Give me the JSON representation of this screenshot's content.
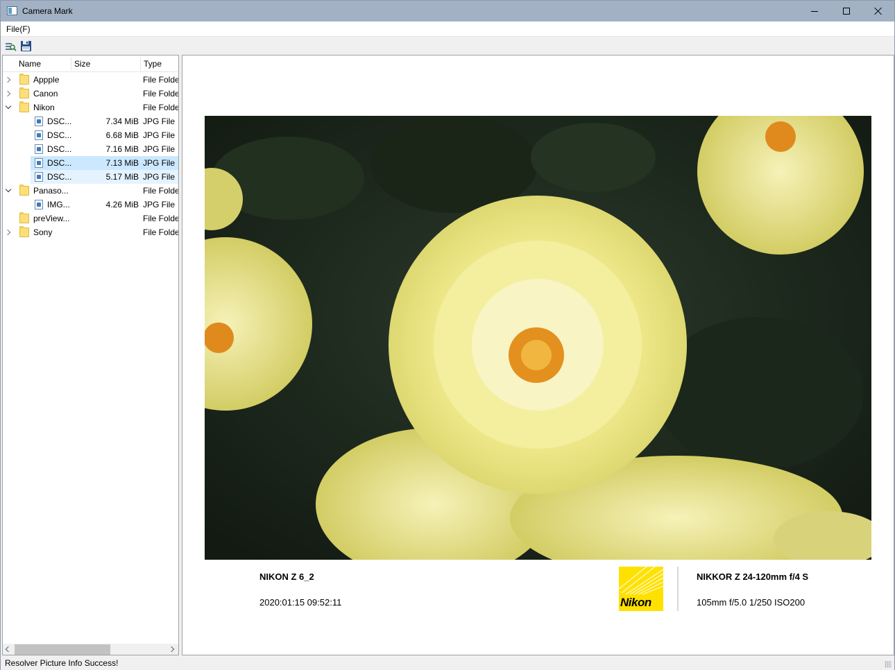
{
  "window": {
    "title": "Camera Mark"
  },
  "menu": {
    "file_label": "File(F)"
  },
  "tree": {
    "columns": {
      "name": "Name",
      "size": "Size",
      "type": "Type"
    },
    "rows": [
      {
        "name": "Appple",
        "size": "",
        "type": "File Folde"
      },
      {
        "name": "Canon",
        "size": "",
        "type": "File Folde"
      },
      {
        "name": "Nikon",
        "size": "",
        "type": "File Folde"
      },
      {
        "name": "DSC...",
        "size": "7.34 MiB",
        "type": "JPG File"
      },
      {
        "name": "DSC...",
        "size": "6.68 MiB",
        "type": "JPG File"
      },
      {
        "name": "DSC...",
        "size": "7.16 MiB",
        "type": "JPG File"
      },
      {
        "name": "DSC...",
        "size": "7.13 MiB",
        "type": "JPG File"
      },
      {
        "name": "DSC...",
        "size": "5.17 MiB",
        "type": "JPG File"
      },
      {
        "name": "Panaso...",
        "size": "",
        "type": "File Folde"
      },
      {
        "name": "IMG...",
        "size": "4.26 MiB",
        "type": "JPG File"
      },
      {
        "name": "preView...",
        "size": "",
        "type": "File Folde"
      },
      {
        "name": "Sony",
        "size": "",
        "type": "File Folde"
      }
    ]
  },
  "preview": {
    "camera_model": "NIKON Z 6_2",
    "datetime": "2020:01:15 09:52:11",
    "brand_logo_text": "Nikon",
    "lens": "NIKKOR Z 24-120mm f/4 S",
    "exposure": "105mm f/5.0 1/250 ISO200"
  },
  "status": {
    "message": "Resolver Picture Info Success!"
  },
  "colors": {
    "titlebar": "#a2b1c4",
    "selection": "#cce8ff",
    "hover": "#e5f3ff",
    "nikon_yellow": "#ffe100"
  }
}
